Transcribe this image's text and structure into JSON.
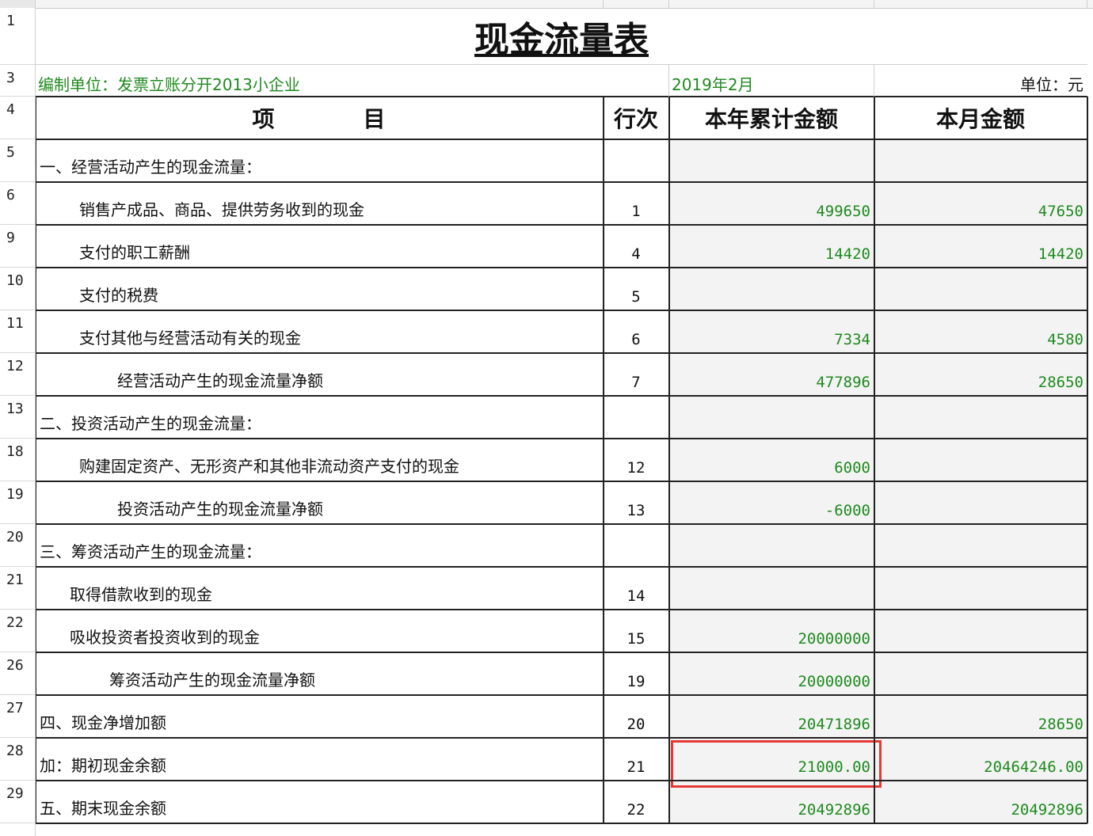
{
  "title": "现金流量表",
  "unit_label": "编制单位：发票立账分开2013小企业",
  "period": "2019年2月",
  "currency_unit": "单位：元",
  "headers": {
    "item": "项　　　　目",
    "line": "行次",
    "ytd": "本年累计金额",
    "month": "本月金额"
  },
  "rows": [
    {
      "rowhdr": "5",
      "item": "一、经营活动产生的现金流量：",
      "line": "",
      "ytd": "",
      "month": ""
    },
    {
      "rowhdr": "6",
      "item": "销售产成品、商品、提供劳务收到的现金",
      "line": "1",
      "ytd": "499650",
      "month": "47650"
    },
    {
      "rowhdr": "9",
      "item": "支付的职工薪酬",
      "line": "4",
      "ytd": "14420",
      "month": "14420"
    },
    {
      "rowhdr": "10",
      "item": "支付的税费",
      "line": "5",
      "ytd": "",
      "month": ""
    },
    {
      "rowhdr": "11",
      "item": "支付其他与经营活动有关的现金",
      "line": "6",
      "ytd": "7334",
      "month": "4580"
    },
    {
      "rowhdr": "12",
      "item": "经营活动产生的现金流量净额",
      "line": "7",
      "ytd": "477896",
      "month": "28650"
    },
    {
      "rowhdr": "13",
      "item": "二、投资活动产生的现金流量：",
      "line": "",
      "ytd": "",
      "month": ""
    },
    {
      "rowhdr": "18",
      "item": "购建固定资产、无形资产和其他非流动资产支付的现金",
      "line": "12",
      "ytd": "6000",
      "month": ""
    },
    {
      "rowhdr": "19",
      "item": "投资活动产生的现金流量净额",
      "line": "13",
      "ytd": "-6000",
      "month": ""
    },
    {
      "rowhdr": "20",
      "item": "三、筹资活动产生的现金流量：",
      "line": "",
      "ytd": "",
      "month": ""
    },
    {
      "rowhdr": "21",
      "item": "取得借款收到的现金",
      "line": "14",
      "ytd": "",
      "month": ""
    },
    {
      "rowhdr": "22",
      "item": "吸收投资者投资收到的现金",
      "line": "15",
      "ytd": "20000000",
      "month": ""
    },
    {
      "rowhdr": "26",
      "item": "筹资活动产生的现金流量净额",
      "line": "19",
      "ytd": "20000000",
      "month": ""
    },
    {
      "rowhdr": "27",
      "item": "四、现金净增加额",
      "line": "20",
      "ytd": "20471896",
      "month": "28650"
    },
    {
      "rowhdr": "28",
      "item": "加：期初现金余额",
      "line": "21",
      "ytd": "21000.00",
      "month": "20464246.00"
    },
    {
      "rowhdr": "29",
      "item": "五、期末现金余额",
      "line": "22",
      "ytd": "20492896",
      "month": "20492896"
    }
  ],
  "highlight_color": "#e53935",
  "value_color": "#1f8a1f"
}
